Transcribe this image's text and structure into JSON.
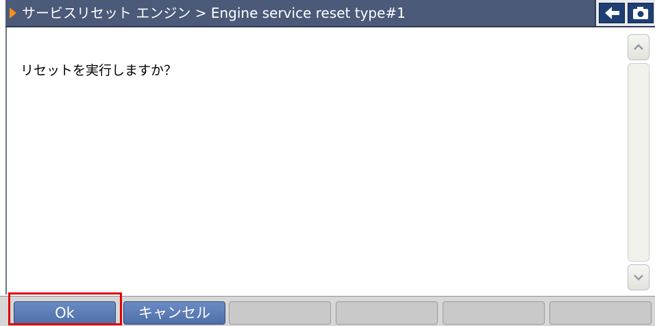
{
  "title": {
    "text": "サービスリセット エンジン > Engine service reset type#1",
    "icons": {
      "marker": "play-arrow-icon",
      "back": "back-arrow-icon",
      "camera": "camera-icon"
    }
  },
  "content": {
    "message": "リセットを実行しますか？"
  },
  "scrollbar": {
    "up_icon": "chevron-up-icon",
    "down_icon": "chevron-down-icon"
  },
  "buttons": [
    {
      "label": "Ok",
      "enabled": true
    },
    {
      "label": "キャンセル",
      "enabled": true
    },
    {
      "label": "",
      "enabled": false
    },
    {
      "label": "",
      "enabled": false
    },
    {
      "label": "",
      "enabled": false
    },
    {
      "label": "",
      "enabled": false
    }
  ],
  "colors": {
    "titlebar": "#4a5a78",
    "marker": "#ff8c1a",
    "active_button": "#5a7bb4",
    "highlight": "#e00000"
  }
}
